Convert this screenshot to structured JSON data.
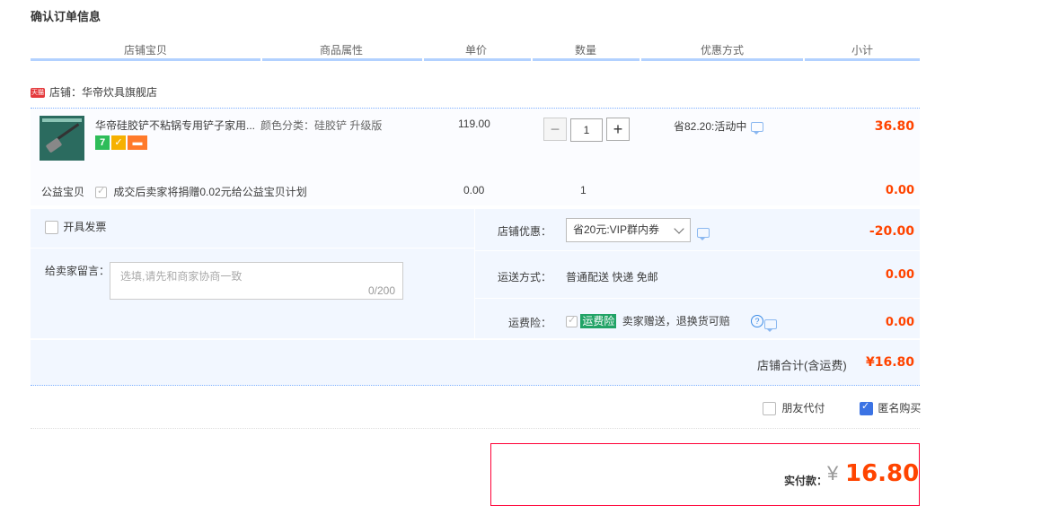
{
  "page_title": "确认订单信息",
  "columns": [
    "店铺宝贝",
    "商品属性",
    "单价",
    "数量",
    "优惠方式",
    "小计"
  ],
  "shop": {
    "badge": "天猫",
    "label": "店铺：华帝炊具旗舰店"
  },
  "item": {
    "name": "华帝硅胶铲不粘锅专用铲子家用...",
    "attr": "颜色分类：硅胶铲 升级版",
    "price": "119.00",
    "qty_minus": "−",
    "qty_value": "1",
    "qty_plus": "+",
    "promo": "省82.20:活动中",
    "subtotal": "36.80",
    "badges": [
      {
        "icon": "seven-day-return-icon",
        "text": "7",
        "color": "#2ebd59"
      },
      {
        "icon": "shield-icon",
        "text": "",
        "color": "#f6b100"
      },
      {
        "icon": "credit-card-icon",
        "text": "",
        "color": "#ff7a2a"
      }
    ]
  },
  "charity": {
    "label": "公益宝贝",
    "text": "成交后卖家将捐赠0.02元给公益宝贝计划",
    "price": "0.00",
    "qty": "1",
    "subtotal": "0.00"
  },
  "invoice_label": "开具发票",
  "message": {
    "label": "给卖家留言：",
    "placeholder": "选填,请先和商家协商一致",
    "counter": "0/200"
  },
  "shop_discount": {
    "label": "店铺优惠：",
    "selected": "省20元:VIP群内券",
    "amount": "-20.00"
  },
  "shipping": {
    "label": "运送方式：",
    "value": "普通配送 快递 免邮",
    "amount": "0.00"
  },
  "insurance": {
    "label": "运费险：",
    "tag": "运费险",
    "text": "卖家赠送，退换货可赔",
    "amount": "0.00"
  },
  "shop_total": {
    "label": "店铺合计(含运费)",
    "amount": "¥16.80"
  },
  "friend_pay": "朋友代付",
  "anonymous": "匿名购买",
  "payment": {
    "label": "实付款：",
    "currency": "¥",
    "amount": "16.80"
  },
  "colors": {
    "accent_red": "#ff4400",
    "highlight_bg": "#f2f7ff",
    "header_bar": "#b2d1ff",
    "pay_border": "#ff0036"
  }
}
